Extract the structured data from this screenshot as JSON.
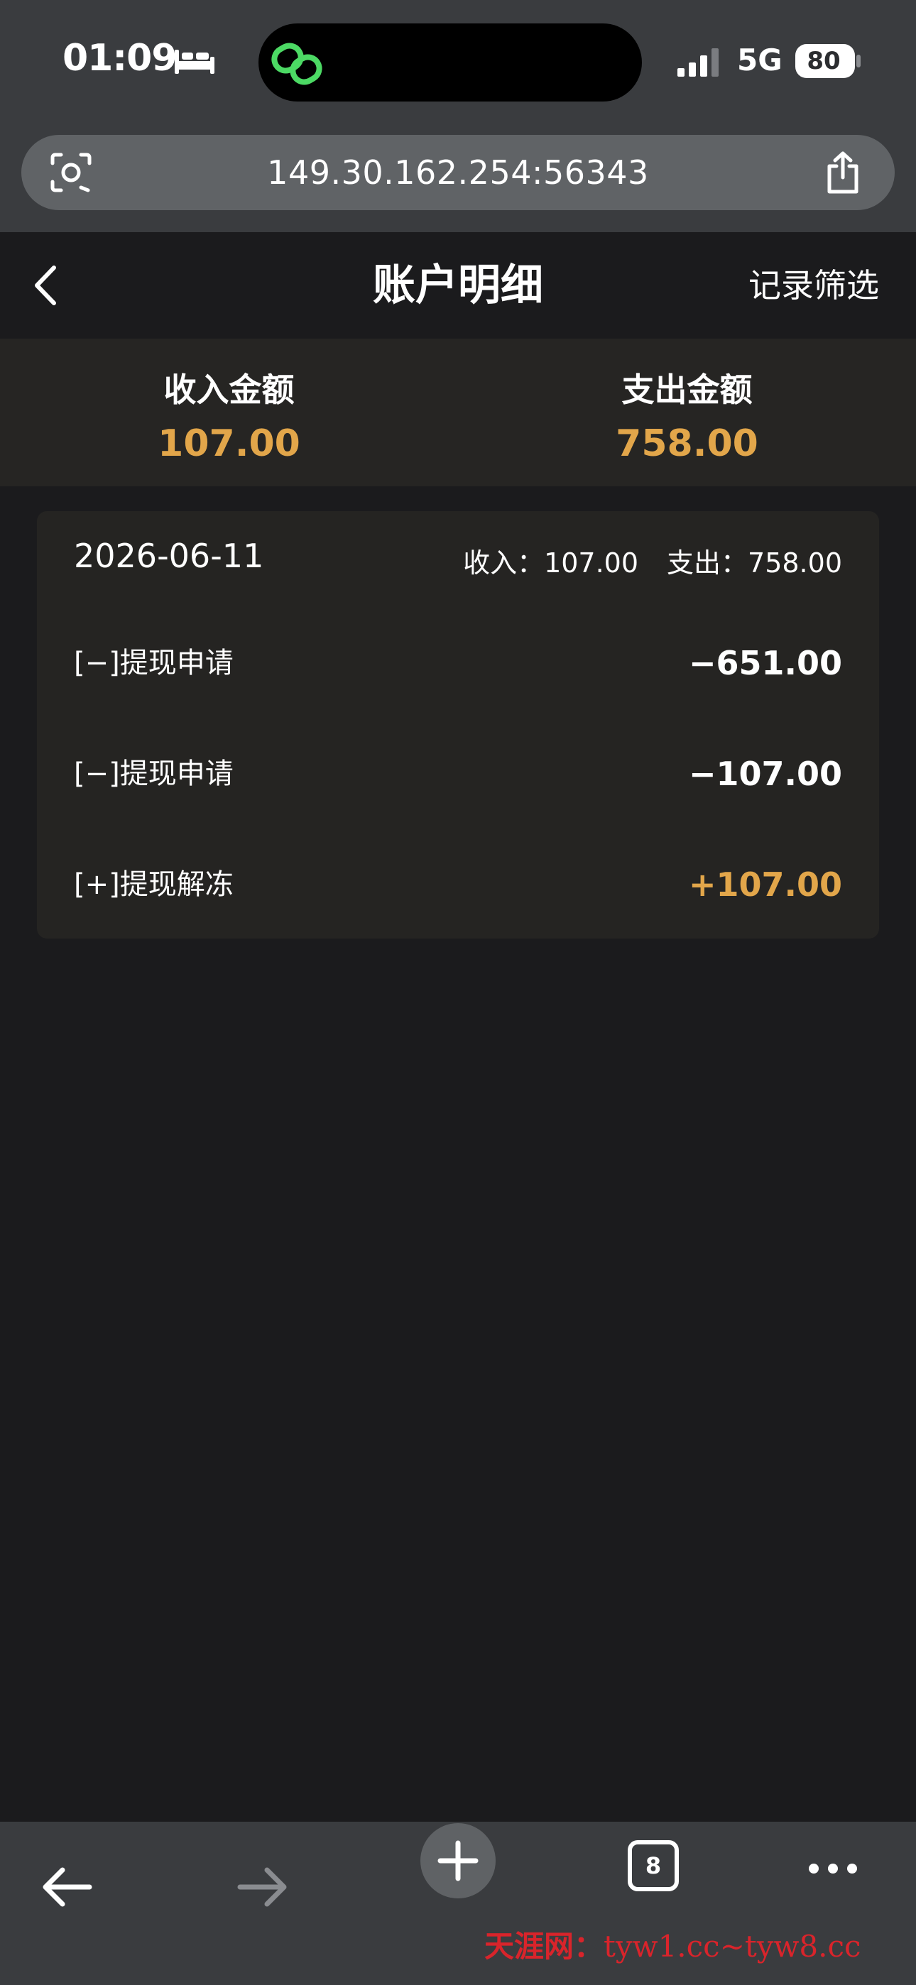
{
  "status_bar": {
    "time": "01:09",
    "network": "5G",
    "battery": "80"
  },
  "browser": {
    "url": "149.30.162.254:56343",
    "tab_count": "8"
  },
  "header": {
    "title": "账户明细",
    "filter_label": "记录筛选"
  },
  "summary": {
    "income_label": "收入金额",
    "income_value": "107.00",
    "expense_label": "支出金额",
    "expense_value": "758.00"
  },
  "records": {
    "date": "2026-06-11",
    "income_text": "收入：107.00",
    "expense_text": "支出：758.00",
    "items": [
      {
        "label": "[−]提现申请",
        "amount": "−651.00"
      },
      {
        "label": "[−]提现申请",
        "amount": "−107.00"
      },
      {
        "label": "[+]提现解冻",
        "amount": "+107.00"
      }
    ]
  },
  "watermark": {
    "brand": "天涯网：",
    "domains": "tyw1.cc~tyw8.cc"
  },
  "colors": {
    "accent": "#e2a64a",
    "chrome": "#3a3c3f",
    "background": "#1b1b1d",
    "card": "#252422",
    "summary_band": "#262523",
    "dynamic_island_icon": "#4cd964",
    "watermark": "#d9242b"
  },
  "icons": {
    "status": [
      "sleep-bed-icon",
      "link-app-icon",
      "cellular-signal-icon",
      "battery-icon"
    ],
    "url_bar": [
      "visual-lookup-icon",
      "share-icon"
    ],
    "header": [
      "chevron-left-icon"
    ],
    "toolbar": [
      "arrow-back-icon",
      "arrow-forward-icon",
      "plus-icon",
      "tabs-icon",
      "more-dots-icon"
    ]
  }
}
